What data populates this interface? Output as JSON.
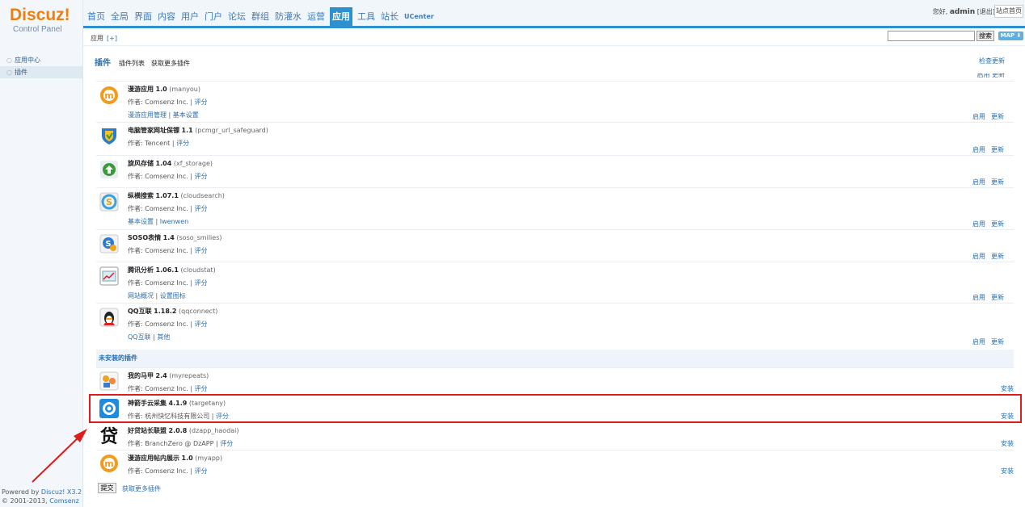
{
  "sidebar": {
    "logo": "Discuz!",
    "subtitle": "Control Panel",
    "items": [
      {
        "label": "应用中心"
      },
      {
        "label": "插件"
      }
    ],
    "powered": "Powered by",
    "powered_link": "Discuz! X3.2",
    "copyright": "© 2001-2013,",
    "copyright_link": "Comsenz Inc."
  },
  "nav": {
    "items": [
      "首页",
      "全局",
      "界面",
      "内容",
      "用户",
      "门户",
      "论坛",
      "群组",
      "防灌水",
      "运营",
      "应用",
      "工具",
      "站长",
      "UCenter"
    ],
    "active": "应用"
  },
  "header": {
    "greeting": "您好,",
    "user": "admin",
    "logout": "[退出]",
    "home": "站点首页",
    "search_btn": "搜索",
    "map": "MAP ⬇"
  },
  "crumb": {
    "text": "应用",
    "plus": "[+]"
  },
  "tabs": {
    "title": "插件",
    "t1": "插件列表",
    "t2": "获取更多插件",
    "check": "检查更新"
  },
  "action_enable": "启用",
  "action_update": "更新",
  "action_install": "安装",
  "installed": [
    {
      "name": "漫游应用",
      "version": "1.0",
      "id": "(manyou)",
      "author": "作者: Comsenz Inc.",
      "links": [
        "漫游应用管理",
        "基本设置"
      ]
    },
    {
      "name": "电脑管家网址保镖",
      "version": "1.1",
      "id": "(pcmgr_url_safeguard)",
      "author": "作者: Tencent",
      "links": []
    },
    {
      "name": "旋风存储",
      "version": "1.04",
      "id": "(xf_storage)",
      "author": "作者: Comsenz Inc.",
      "links": []
    },
    {
      "name": "纵横搜索",
      "version": "1.07.1",
      "id": "(cloudsearch)",
      "author": "作者: Comsenz Inc.",
      "links": [
        "基本设置",
        "Iwenwen"
      ]
    },
    {
      "name": "SOSO表情",
      "version": "1.4",
      "id": "(soso_smilies)",
      "author": "作者: Comsenz Inc.",
      "links": []
    },
    {
      "name": "腾讯分析",
      "version": "1.06.1",
      "id": "(cloudstat)",
      "author": "作者: Comsenz Inc.",
      "links": [
        "网站概况",
        "设置图标"
      ]
    },
    {
      "name": "QQ互联",
      "version": "1.18.2",
      "id": "(qqconnect)",
      "author": "作者: Comsenz Inc.",
      "links": [
        "QQ互联",
        "其他"
      ]
    }
  ],
  "rate": "评分",
  "uninstalled_header": "未安装的插件",
  "uninstalled": [
    {
      "name": "我的马甲",
      "version": "2.4",
      "id": "(myrepeats)",
      "author": "作者: Comsenz Inc."
    },
    {
      "name": "神箭手云采集",
      "version": "4.1.9",
      "id": "(targetany)",
      "author": "作者: 杭州快忆科技有限公司"
    },
    {
      "name": "好贷站长联盟",
      "version": "2.0.8",
      "id": "(dzapp_haodai)",
      "author": "作者: BranchZero @ DzAPP"
    },
    {
      "name": "漫游应用帖内展示",
      "version": "1.0",
      "id": "(myapp)",
      "author": "作者: Comsenz Inc."
    }
  ],
  "footer": {
    "submit": "提交",
    "more": "获取更多插件"
  }
}
